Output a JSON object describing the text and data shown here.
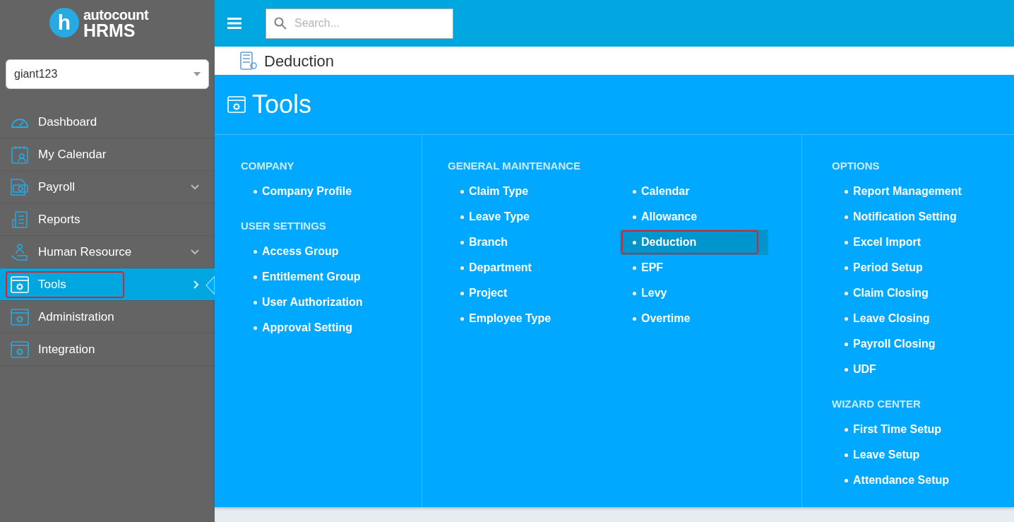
{
  "logo": {
    "mark": "h",
    "brand": "autocount",
    "product": "HRMS"
  },
  "company_select": {
    "value": "giant123"
  },
  "sidebar": {
    "items": [
      {
        "label": "Dashboard",
        "expandable": false,
        "selected": false
      },
      {
        "label": "My Calendar",
        "expandable": false,
        "selected": false
      },
      {
        "label": "Payroll",
        "expandable": true,
        "selected": false
      },
      {
        "label": "Reports",
        "expandable": false,
        "selected": false
      },
      {
        "label": "Human Resource",
        "expandable": true,
        "selected": false
      },
      {
        "label": "Tools",
        "expandable": true,
        "selected": true
      },
      {
        "label": "Administration",
        "expandable": false,
        "selected": false
      },
      {
        "label": "Integration",
        "expandable": false,
        "selected": false
      }
    ]
  },
  "search": {
    "placeholder": "Search..."
  },
  "page": {
    "title": "Deduction"
  },
  "menu": {
    "title": "Tools",
    "columns": [
      {
        "sections": [
          {
            "title": "COMPANY",
            "item_columns": [
              [
                {
                  "label": "Company Profile",
                  "selected": false
                }
              ]
            ]
          },
          {
            "title": "USER SETTINGS",
            "item_columns": [
              [
                {
                  "label": "Access Group",
                  "selected": false
                },
                {
                  "label": "Entitlement Group",
                  "selected": false
                },
                {
                  "label": "User Authorization",
                  "selected": false
                },
                {
                  "label": "Approval Setting",
                  "selected": false
                }
              ]
            ]
          }
        ]
      },
      {
        "sections": [
          {
            "title": "GENERAL MAINTENANCE",
            "item_columns": [
              [
                {
                  "label": "Claim Type",
                  "selected": false
                },
                {
                  "label": "Leave Type",
                  "selected": false
                },
                {
                  "label": "Branch",
                  "selected": false
                },
                {
                  "label": "Department",
                  "selected": false
                },
                {
                  "label": "Project",
                  "selected": false
                },
                {
                  "label": "Employee Type",
                  "selected": false
                }
              ],
              [
                {
                  "label": "Calendar",
                  "selected": false
                },
                {
                  "label": "Allowance",
                  "selected": false
                },
                {
                  "label": "Deduction",
                  "selected": true
                },
                {
                  "label": "EPF",
                  "selected": false
                },
                {
                  "label": "Levy",
                  "selected": false
                },
                {
                  "label": "Overtime",
                  "selected": false
                }
              ]
            ]
          }
        ]
      },
      {
        "sections": [
          {
            "title": "OPTIONS",
            "item_columns": [
              [
                {
                  "label": "Report Management",
                  "selected": false
                },
                {
                  "label": "Notification Setting",
                  "selected": false
                },
                {
                  "label": "Excel Import",
                  "selected": false
                },
                {
                  "label": "Period Setup",
                  "selected": false
                },
                {
                  "label": "Claim Closing",
                  "selected": false
                },
                {
                  "label": "Leave Closing",
                  "selected": false
                },
                {
                  "label": "Payroll Closing",
                  "selected": false
                },
                {
                  "label": "UDF",
                  "selected": false
                }
              ]
            ]
          },
          {
            "title": "WIZARD CENTER",
            "item_columns": [
              [
                {
                  "label": "First Time Setup",
                  "selected": false
                },
                {
                  "label": "Leave Setup",
                  "selected": false
                },
                {
                  "label": "Attendance Setup",
                  "selected": false
                }
              ]
            ]
          }
        ]
      }
    ]
  }
}
